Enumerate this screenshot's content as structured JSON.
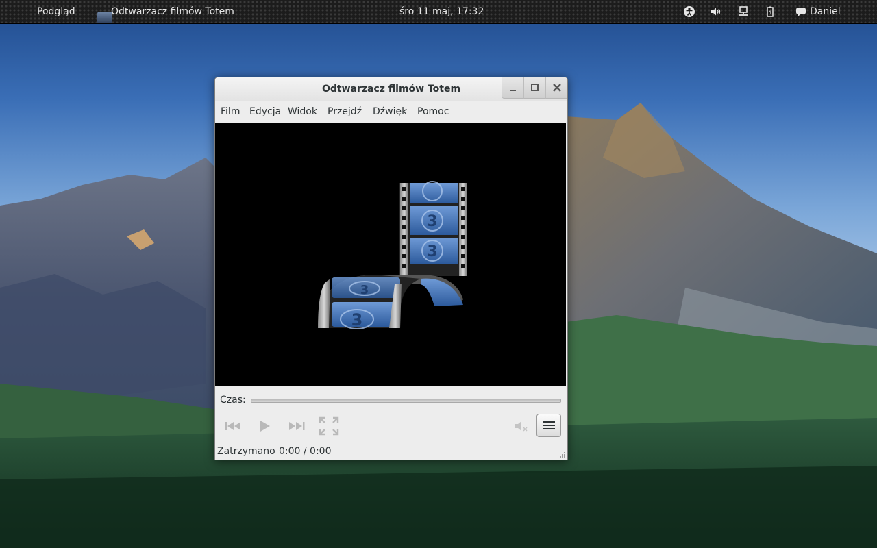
{
  "topbar": {
    "activities": "Podgląd",
    "app_menu": "Odtwarzacz filmów Totem",
    "clock": "śro 11 maj, 17:32",
    "user": "Daniel",
    "tray_icons": [
      "accessibility-icon",
      "volume-icon",
      "network-icon",
      "battery-icon"
    ]
  },
  "window": {
    "title": "Odtwarzacz filmów Totem",
    "controls": [
      "minimize",
      "maximize",
      "close"
    ]
  },
  "menubar": {
    "items": [
      "Film",
      "Edycja",
      "Widok",
      "Przejdź",
      "Dźwięk",
      "Pomoc"
    ]
  },
  "player": {
    "logo": "totem-film-reel",
    "time_label": "Czas:",
    "seek_position": 0,
    "buttons": [
      "previous",
      "play",
      "next",
      "fullscreen",
      "mute",
      "menu"
    ],
    "status": "Zatrzymano",
    "time": "0:00 / 0:00"
  },
  "colors": {
    "topbar_bg": "#1c1c1c",
    "window_bg": "#ededed",
    "video_bg": "#000000",
    "film_blue": "#3a6ab0"
  }
}
